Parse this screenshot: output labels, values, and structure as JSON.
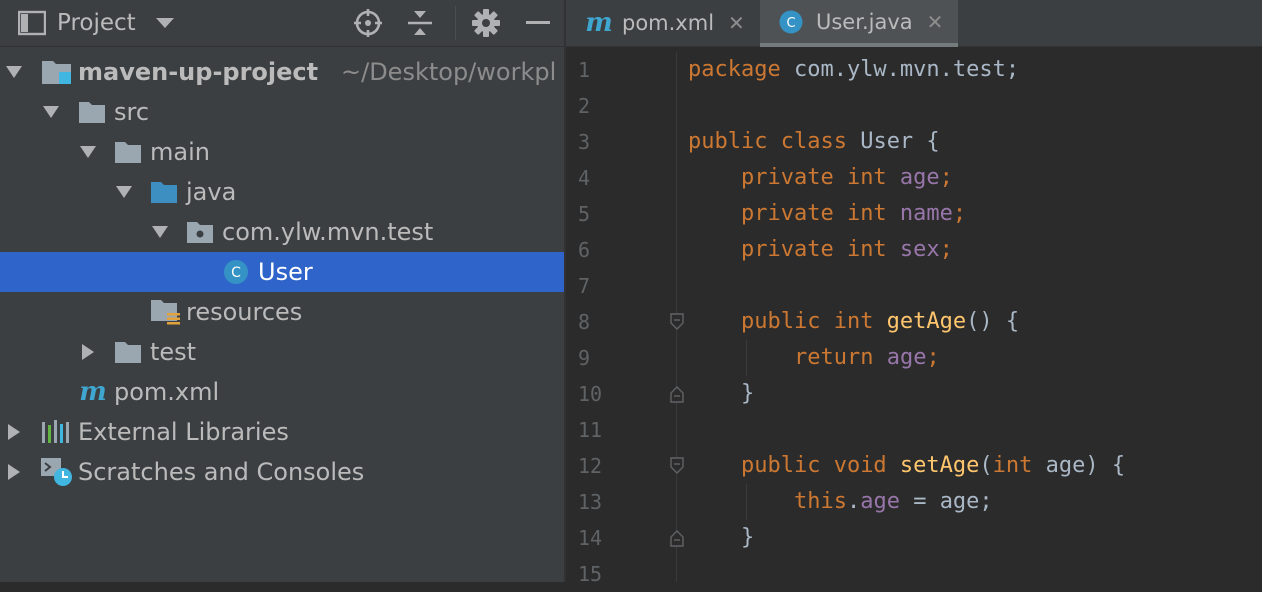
{
  "project_panel": {
    "title": "Project",
    "icons": [
      "project-view-icon",
      "dropdown-icon",
      "locate-icon",
      "collapse-all-icon",
      "gear-icon",
      "hide-icon"
    ]
  },
  "tree": [
    {
      "name": "maven-up-project",
      "path": "~/Desktop/workpl",
      "icon": "module-folder-icon",
      "expanded": true
    },
    {
      "name": "src",
      "icon": "folder-icon",
      "expanded": true
    },
    {
      "name": "main",
      "icon": "folder-icon",
      "expanded": true
    },
    {
      "name": "java",
      "icon": "source-folder-icon",
      "expanded": true
    },
    {
      "name": "com.ylw.mvn.test",
      "icon": "package-icon",
      "expanded": true
    },
    {
      "name": "User",
      "icon": "class-icon",
      "selected": true
    },
    {
      "name": "resources",
      "icon": "resources-folder-icon"
    },
    {
      "name": "test",
      "icon": "folder-icon",
      "expanded": false
    },
    {
      "name": "pom.xml",
      "icon": "maven-icon"
    },
    {
      "name": "External Libraries",
      "icon": "libraries-icon",
      "expanded": false
    },
    {
      "name": "Scratches and Consoles",
      "icon": "scratches-icon",
      "expanded": false
    }
  ],
  "editor": {
    "tabs": [
      {
        "label": "pom.xml",
        "icon": "maven-icon",
        "active": false
      },
      {
        "label": "User.java",
        "icon": "class-icon",
        "active": true
      }
    ],
    "line_numbers": [
      "1",
      "2",
      "3",
      "4",
      "5",
      "6",
      "7",
      "8",
      "9",
      "10",
      "11",
      "12",
      "13",
      "14",
      "15"
    ],
    "code": {
      "l1_kw": "package",
      "l1_rest": " com.ylw.mvn.test;",
      "l3_kw": "public class",
      "l3_cls": " User",
      "l3_rest": " {",
      "l4_kw": "private int",
      "l4_fld": " age",
      "l4_rest": ";",
      "l5_kw": "private int",
      "l5_fld": " name",
      "l5_rest": ";",
      "l6_kw": "private int",
      "l6_fld": " sex",
      "l6_rest": ";",
      "l8_kw": "public int",
      "l8_fn": " getAge",
      "l8_rest": "() {",
      "l9_kw": "return",
      "l9_fld": " age",
      "l9_rest": ";",
      "l10": "}",
      "l12_kw": "public void",
      "l12_fn": " setAge",
      "l12_p1": "(",
      "l12_kw2": "int",
      "l12_p2": " age) {",
      "l13_kw": "this",
      "l13_dot": ".",
      "l13_fld": "age",
      "l13_rest": " = age;",
      "l14": "}"
    }
  },
  "colors": {
    "panel_bg": "#3c3f41",
    "editor_bg": "#2b2b2b",
    "selection": "#2f65ca",
    "keyword": "#cc7832",
    "field": "#9876aa",
    "method": "#ffc66d",
    "text": "#a9b7c6",
    "maven": "#3fa6cf",
    "class_icon": "#3592c4"
  }
}
